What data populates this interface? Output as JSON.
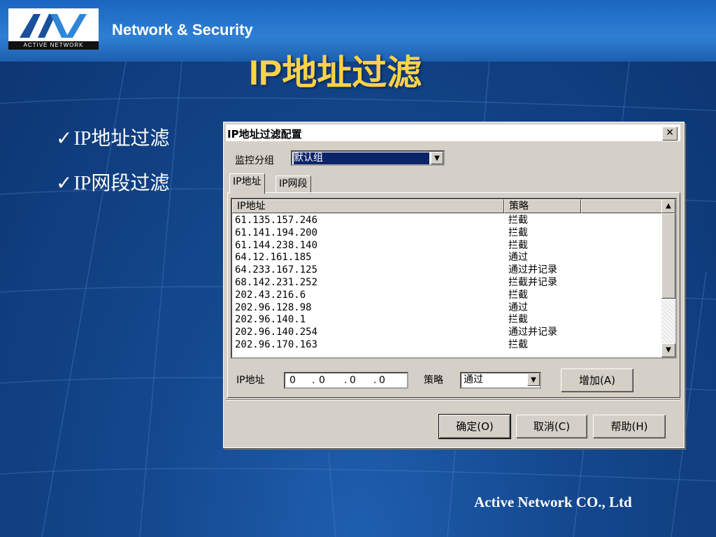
{
  "slide": {
    "logo_text": "ACTIVE NETWORK",
    "brand": "Network & Security",
    "title": "IP地址过滤",
    "bullets": [
      {
        "check": "✓",
        "text": "IP地址过滤"
      },
      {
        "check": "✓",
        "text": "IP网段过滤"
      }
    ],
    "footer": "Active Network CO., Ltd"
  },
  "dialog": {
    "title": "IP地址过滤配置",
    "close_glyph": "✕",
    "monitor_group_label": "监控分组",
    "monitor_group_value": "默认组",
    "tabs": [
      {
        "label": "IP地址",
        "active": true
      },
      {
        "label": "IP网段",
        "active": false
      }
    ],
    "list": {
      "columns": [
        "IP地址",
        "策略",
        ""
      ],
      "rows": [
        {
          "ip": "61.135.157.246",
          "policy": "拦截"
        },
        {
          "ip": "61.141.194.200",
          "policy": "拦截"
        },
        {
          "ip": "61.144.238.140",
          "policy": "拦截"
        },
        {
          "ip": "64.12.161.185",
          "policy": "通过"
        },
        {
          "ip": "64.233.167.125",
          "policy": "通过并记录"
        },
        {
          "ip": "68.142.231.252",
          "policy": "拦截并记录"
        },
        {
          "ip": "202.43.216.6",
          "policy": "拦截"
        },
        {
          "ip": "202.96.128.98",
          "policy": "通过"
        },
        {
          "ip": "202.96.140.1",
          "policy": "拦截"
        },
        {
          "ip": "202.96.140.254",
          "policy": "通过并记录"
        },
        {
          "ip": "202.96.170.163",
          "policy": "拦截"
        }
      ]
    },
    "ip_label": "IP地址",
    "ip_octets": [
      "0",
      "0",
      "0",
      "0"
    ],
    "policy_label": "策略",
    "policy_value": "通过",
    "add_button": "增加(A)",
    "ok_button": "确定(O)",
    "cancel_button": "取消(C)",
    "help_button": "帮助(H)"
  },
  "colors": {
    "background": "#14498f",
    "title": "#ffd24a",
    "selection": "#0a246a",
    "dialog_face": "#d4d0c8"
  }
}
